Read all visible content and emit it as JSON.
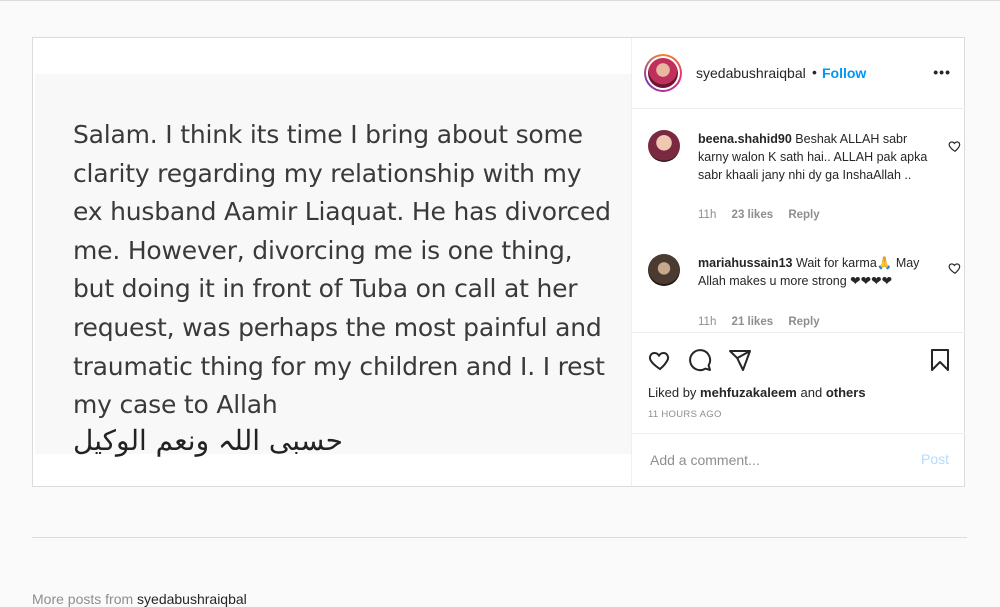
{
  "post": {
    "image_text": "Salam. I think its time I bring about some clarity regarding my relationship with my ex husband Aamir Liaquat. He has divorced me. However, divorcing me is one thing, but doing it in front of Tuba on call at her request, was perhaps the most painful and traumatic thing for my children and I. I rest my case to Allah",
    "image_arabic": "حسبی اللہ ونعم الوکیل"
  },
  "header": {
    "username": "syedabushraiqbal",
    "dot": "•",
    "follow_label": "Follow",
    "more_icon": "more-horizontal-icon"
  },
  "comments": [
    {
      "username": "beena.shahid90",
      "text": "Beshak ALLAH sabr karny walon K sath hai.. ALLAH pak apka sabr khaali jany nhi dy ga InshaAllah ..",
      "time": "11h",
      "likes": "23 likes",
      "reply": "Reply"
    },
    {
      "username": "mariahussain13",
      "text": "Wait for karma🙏 May Allah makes u more strong ❤❤❤❤",
      "time": "11h",
      "likes": "21 likes",
      "reply": "Reply"
    }
  ],
  "actions": {
    "icons": [
      "heart-icon",
      "comment-icon",
      "share-icon",
      "bookmark-icon"
    ]
  },
  "liked_by": {
    "prefix": "Liked by",
    "user": "mehfuzakaleem",
    "and": "and",
    "others": "others"
  },
  "time_ago": "11 HOURS AGO",
  "comment_box": {
    "placeholder": "Add a comment...",
    "post_label": "Post"
  },
  "more_posts": {
    "prefix": "More posts from",
    "user": "syedabushraiqbal"
  },
  "colors": {
    "follow": "#0095f6",
    "post_disabled": "#b3dbff",
    "meta": "#8e8e8e"
  }
}
